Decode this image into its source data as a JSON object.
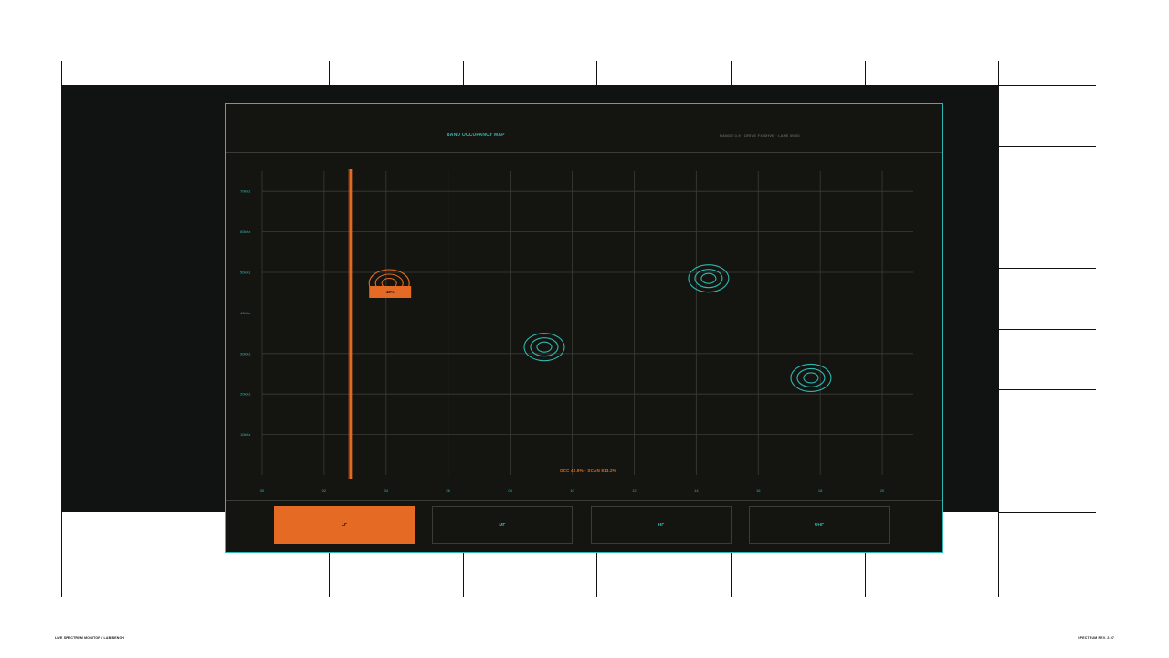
{
  "panel": {
    "title": "BAND OCCUPANCY MAP",
    "meta": "RANGE 0-9 · DRIVE FX/SHVE · LANE 09/00"
  },
  "chart_data": {
    "type": "scatter",
    "x_ticks": [
      "00",
      "02",
      "04",
      "06",
      "08",
      "10",
      "12",
      "14",
      "16",
      "18",
      "20"
    ],
    "y_ticks": [
      "10kHz",
      "20kHz",
      "30kHz",
      "40kHz",
      "50kHz",
      "60kHz",
      "70kHz"
    ],
    "xlim": [
      0,
      21
    ],
    "ylim": [
      0,
      75
    ],
    "grid": true,
    "cursor_x": 2.85,
    "selected_marker_label": "48%",
    "signals": [
      {
        "x": 4.1,
        "y": 47.3,
        "selected": true
      },
      {
        "x": 9.1,
        "y": 31.6,
        "selected": false
      },
      {
        "x": 14.4,
        "y": 48.5,
        "selected": false
      },
      {
        "x": 17.7,
        "y": 24.0,
        "selected": false
      }
    ],
    "readout": "OCC 42.9% · SCAN 813.2%",
    "colors": {
      "accent": "#2fb7b1",
      "highlight": "#e56b24",
      "grid": "#3a3c37"
    }
  },
  "tabs": [
    {
      "label": "LF",
      "active": true
    },
    {
      "label": "MF",
      "active": false
    },
    {
      "label": "HF",
      "active": false
    },
    {
      "label": "UHF",
      "active": false
    }
  ],
  "footer": {
    "left": "LIVE SPECTRUM MONITOR / LAB BENCH",
    "right": "SPECTRUM REV. 2.07"
  }
}
